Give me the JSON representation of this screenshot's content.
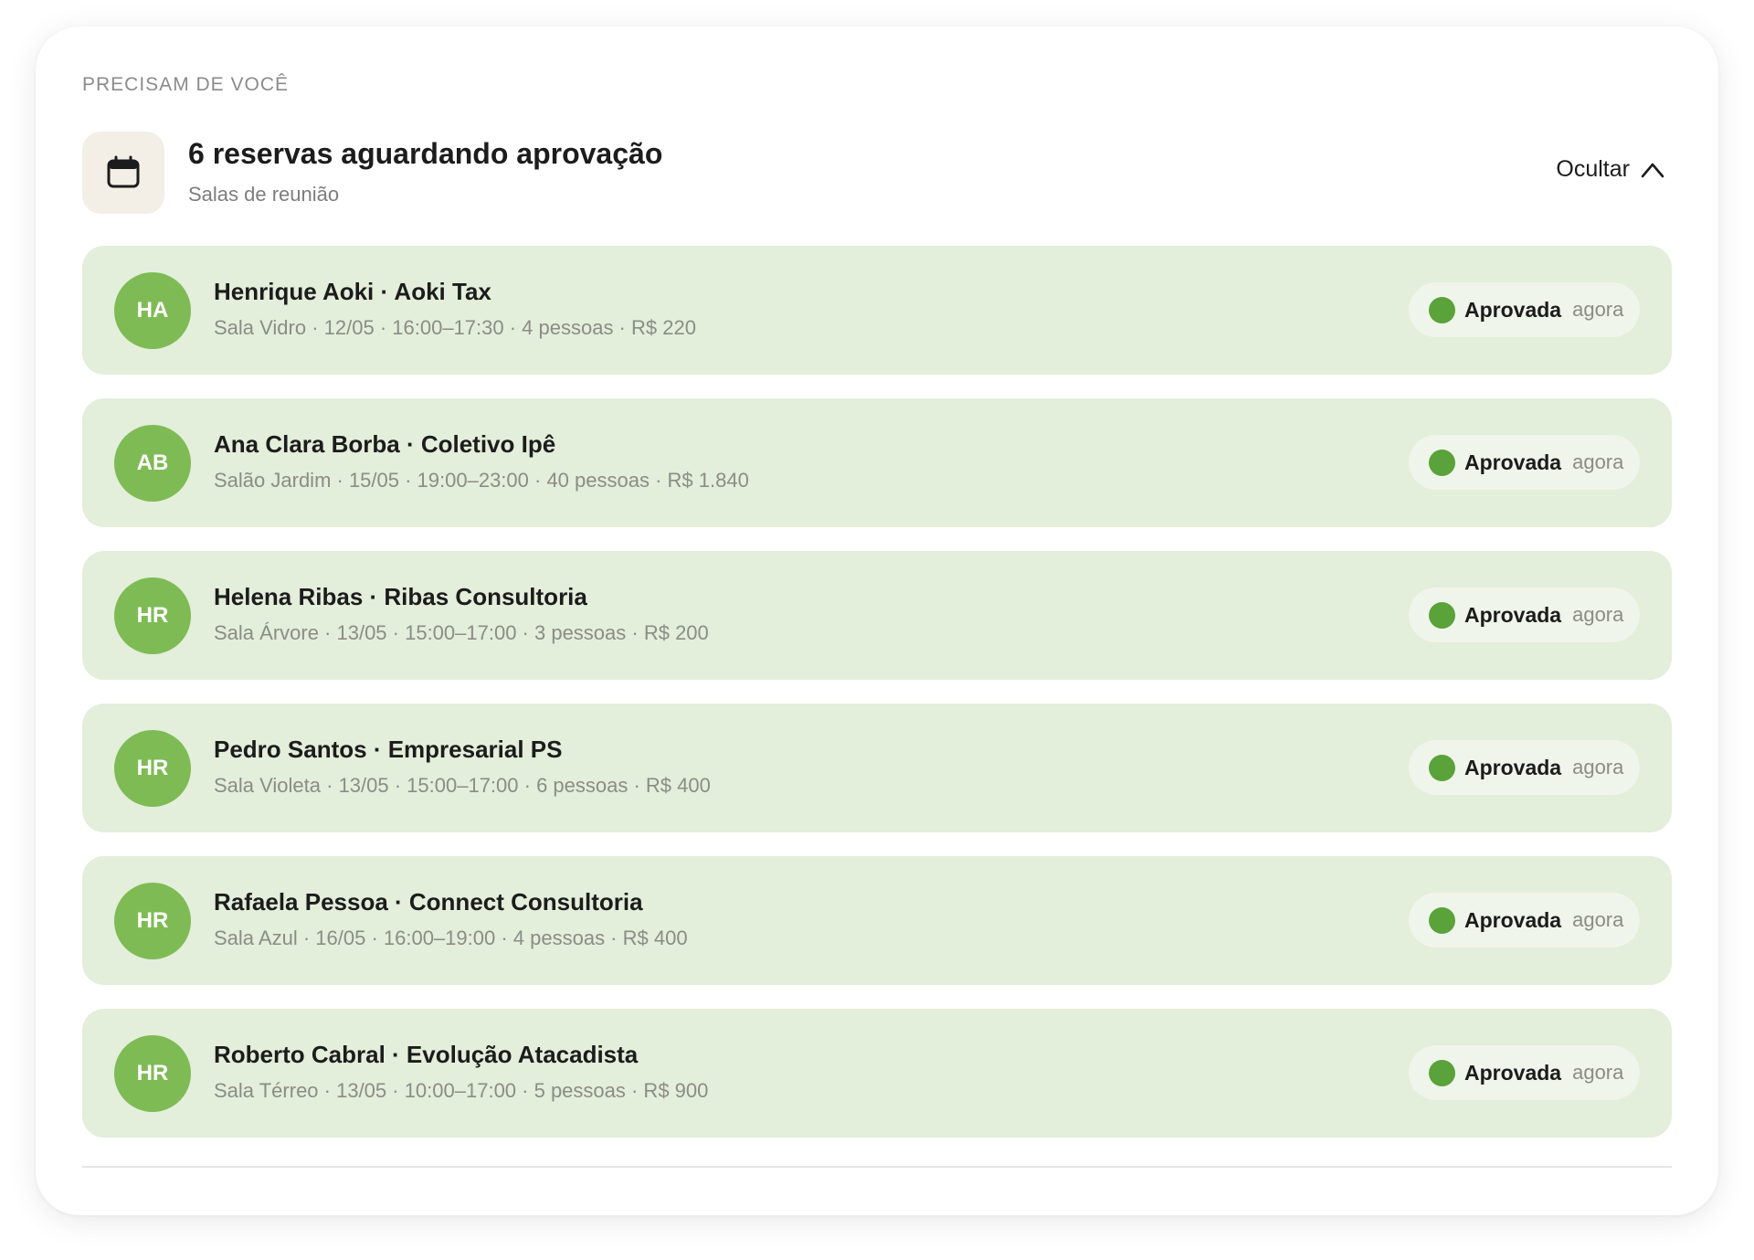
{
  "section": {
    "eyebrow": "PRECISAM DE VOCÊ",
    "title": "6 reservas aguardando aprovação",
    "subtitle": "Salas de reunião",
    "hide_label": "Ocultar",
    "icon": "calendar-icon"
  },
  "colors": {
    "row_background": "#e3eedb",
    "avatar": "#7fbb55",
    "status_dot": "#5aa23a",
    "icon_box": "#f3efe6"
  },
  "reservations": [
    {
      "initials": "HA",
      "title": "Henrique Aoki · Aoki Tax",
      "details": "Sala Vidro · 12/05 · 16:00–17:30 · 4 pessoas · R$ 220",
      "status": "Aprovada",
      "time": "agora"
    },
    {
      "initials": "AB",
      "title": "Ana Clara Borba · Coletivo Ipê",
      "details": "Salão Jardim · 15/05 · 19:00–23:00 · 40 pessoas · R$ 1.840",
      "status": "Aprovada",
      "time": "agora"
    },
    {
      "initials": "HR",
      "title": "Helena Ribas · Ribas Consultoria",
      "details": "Sala Árvore · 13/05 · 15:00–17:00 · 3 pessoas · R$ 200",
      "status": "Aprovada",
      "time": "agora"
    },
    {
      "initials": "HR",
      "title": "Pedro Santos · Empresarial PS",
      "details": "Sala Violeta · 13/05 · 15:00–17:00 · 6 pessoas · R$ 400",
      "status": "Aprovada",
      "time": "agora"
    },
    {
      "initials": "HR",
      "title": "Rafaela Pessoa · Connect Consultoria",
      "details": "Sala Azul · 16/05 · 16:00–19:00 · 4 pessoas · R$ 400",
      "status": "Aprovada",
      "time": "agora"
    },
    {
      "initials": "HR",
      "title": "Roberto Cabral · Evolução Atacadista",
      "details": "Sala Térreo · 13/05 · 10:00–17:00 · 5 pessoas · R$ 900",
      "status": "Aprovada",
      "time": "agora"
    }
  ]
}
